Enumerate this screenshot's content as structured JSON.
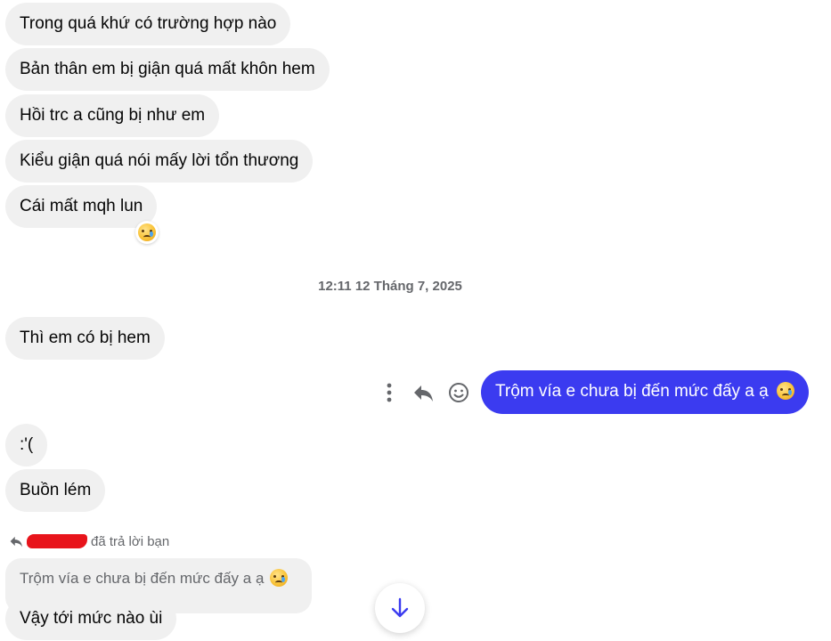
{
  "messages_before": [
    {
      "text": "Trong quá khứ có trường hợp nào"
    },
    {
      "text": "Bản thân em bị giận quá mất khôn hem"
    },
    {
      "text": "Hồi trc a cũng bị như em"
    },
    {
      "text": "Kiểu giận quá nói mấy lời tổn thương"
    },
    {
      "text": "Cái mất mqh lun"
    }
  ],
  "timestamp": "12:11 12 Tháng 7, 2025",
  "incoming_1": "Thì em có bị hem",
  "outgoing_1": "Trộm vía e chưa bị đến mức đấy a ạ",
  "incoming_2": ":'(",
  "incoming_3": "Buồn lém",
  "reply_label": "đã trả lời bạn",
  "quoted_text": "Trộm vía e chưa bị đến mức đấy a ạ",
  "incoming_4": "Vậy tới mức nào ùi",
  "colors": {
    "outgoing_bubble": "#3b3bf0",
    "incoming_bubble": "#f0f0f0",
    "scroll_arrow": "#3b3bf0"
  },
  "icons": {
    "reaction": "crying-face-icon",
    "more": "more-vertical-icon",
    "reply": "reply-icon",
    "react": "smiley-icon",
    "scroll": "arrow-down-icon"
  }
}
